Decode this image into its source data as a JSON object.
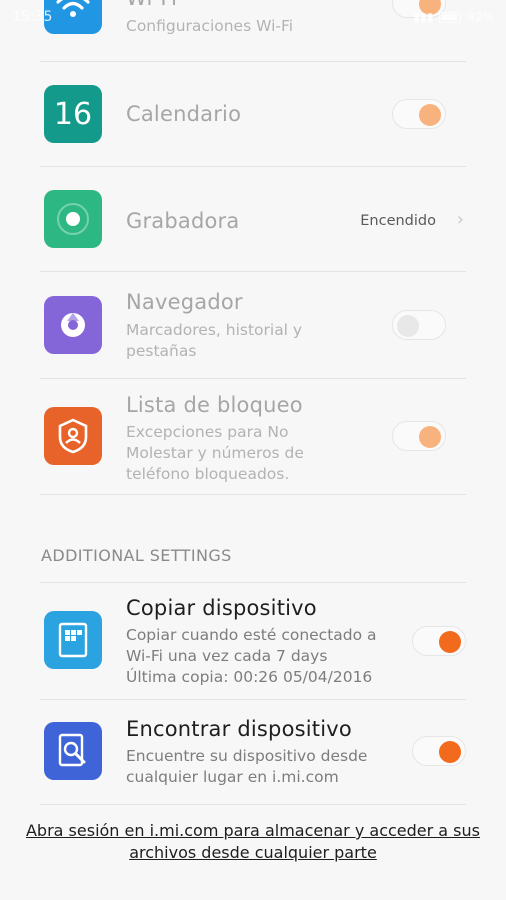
{
  "status": {
    "time": "15:35",
    "battery": "92%"
  },
  "apps": [
    {
      "title": "Wi-Fi",
      "subtitle": "Configuraciones Wi-Fi",
      "toggle": "on"
    },
    {
      "title": "Calendario",
      "calendar_day": "16",
      "toggle": "on"
    },
    {
      "title": "Grabadora",
      "value": "Encendido"
    },
    {
      "title": "Navegador",
      "subtitle": "Marcadores, historial y pestañas",
      "toggle": "off"
    },
    {
      "title": "Lista de bloqueo",
      "subtitle": "Excepciones para No Molestar y números de teléfono bloqueados.",
      "toggle": "on"
    }
  ],
  "additional": {
    "header": "ADDITIONAL SETTINGS",
    "items": [
      {
        "title": "Copiar dispositivo",
        "subtitle": "Copiar cuando esté conectado a Wi-Fi una vez cada 7 days",
        "subtitle2": "Última copia: 00:26 05/04/2016",
        "toggle": "on"
      },
      {
        "title": "Encontrar dispositivo",
        "subtitle": "Encuentre su dispositivo desde cualquier lugar en i.mi.com",
        "toggle": "on"
      }
    ]
  },
  "footer": {
    "link": "Abra sesión en i.mi.com para almacenar y acceder a sus archivos desde cualquier parte"
  },
  "colors": {
    "toggle_on_dim": "#f7b27e",
    "toggle_on": "#f26a1b",
    "wifi": "#2196e3",
    "calendar": "#139a8a",
    "recorder": "#2db883",
    "browser": "#8466d8",
    "blocklist": "#e8632a",
    "backup": "#2aa3e0",
    "find": "#3f64d8"
  }
}
